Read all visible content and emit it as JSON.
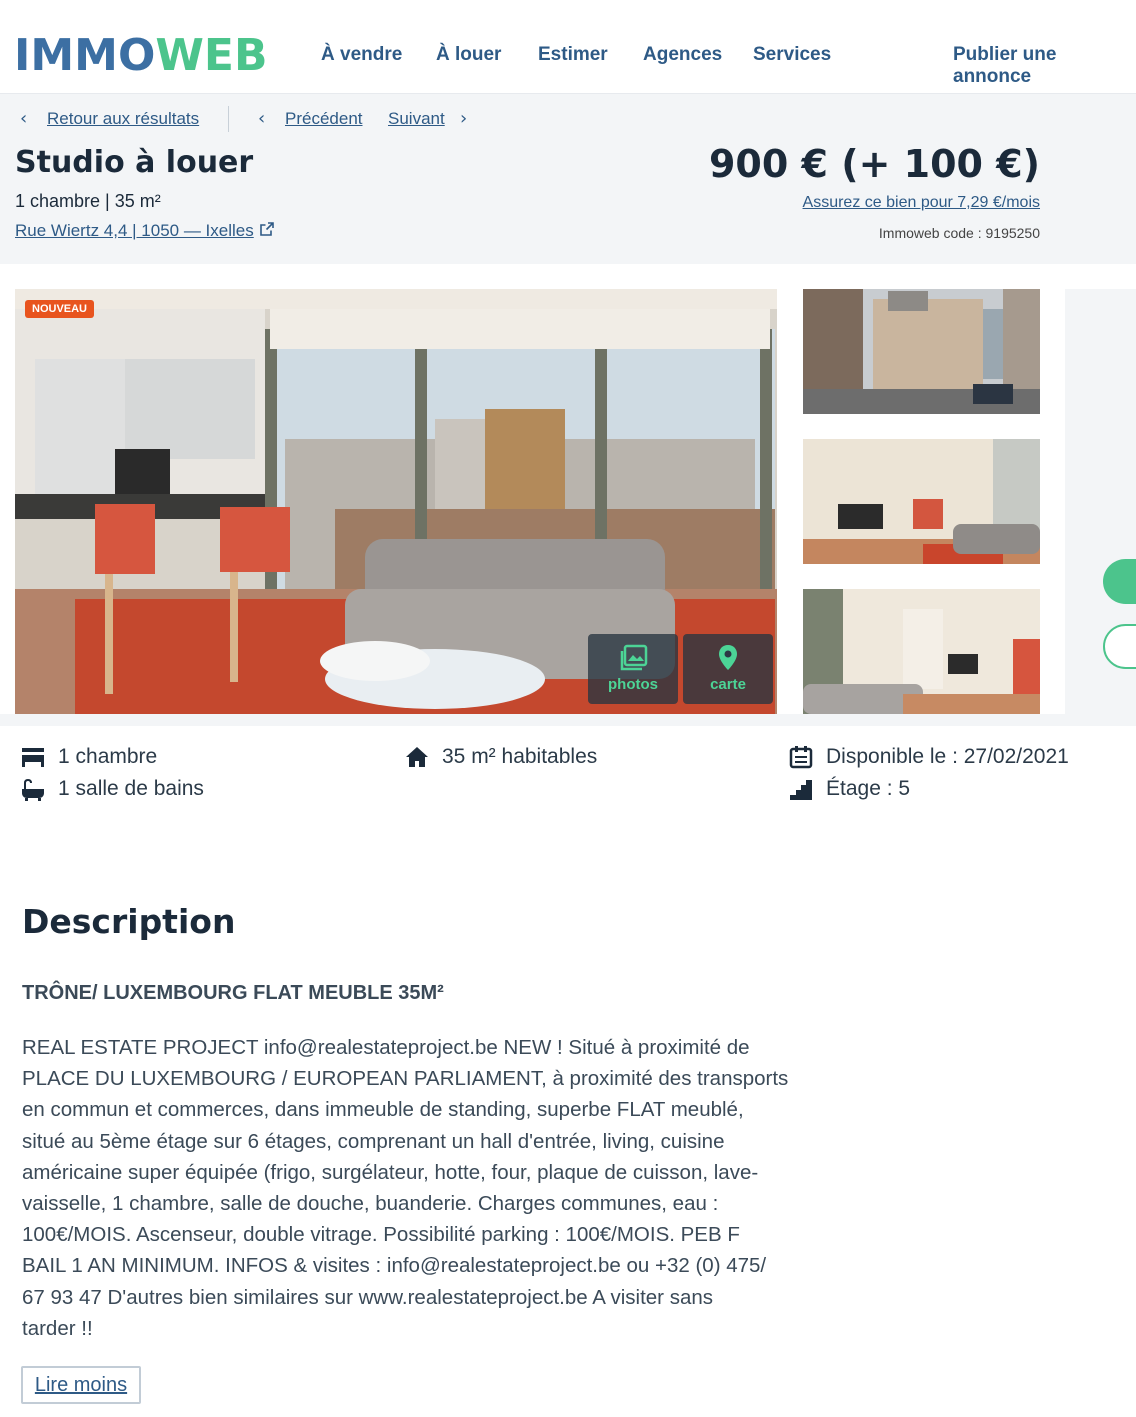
{
  "nav": {
    "logo_part1": "IMMO",
    "logo_part2": "WEB",
    "links": [
      "À vendre",
      "À louer",
      "Estimer",
      "Agences",
      "Services"
    ],
    "publish": "Publier une annonce"
  },
  "breadcrumb": {
    "back": "Retour aux résultats",
    "previous": "Précédent",
    "next": "Suivant"
  },
  "listing": {
    "title": "Studio à louer",
    "subtitle": "1 chambre | 35 m²",
    "address": "Rue Wiertz 4,4 | 1050 — Ixelles",
    "price": "900 € (+ 100 €)",
    "insurance_link": "Assurez ce bien pour 7,29 €/mois",
    "code": "Immoweb code : 9195250"
  },
  "gallery": {
    "badge": "NOUVEAU",
    "photos_label": "photos",
    "map_label": "carte"
  },
  "features": {
    "bedrooms": "1 chambre",
    "bathrooms": "1 salle de bains",
    "living_area": "35 m² habitables",
    "available": "Disponible le : 27/02/2021",
    "floor": "Étage : 5"
  },
  "description": {
    "heading": "Description",
    "subheading": "TRÔNE/ LUXEMBOURG FLAT MEUBLE 35M²",
    "lines": [
      "REAL ESTATE PROJECT info@realestateproject.be NEW ! Situé à proximité de",
      "PLACE DU LUXEMBOURG / EUROPEAN PARLIAMENT, à proximité des transports",
      "en commun et commerces, dans immeuble de standing, superbe FLAT meublé,",
      "situé au 5ème étage sur 6 étages, comprenant un hall d'entrée, living, cuisine",
      "américaine super équipée (frigo, surgélateur, hotte, four, plaque de cuisson, lave-",
      "vaisselle, 1 chambre, salle de douche, buanderie. Charges communes, eau :",
      "100€/MOIS. Ascenseur, double vitrage. Possibilité parking : 100€/MOIS. PEB F",
      "BAIL 1 AN MINIMUM. INFOS & visites : info@realestateproject.be ou +32 (0) 475/",
      "67 93 47 D'autres bien similaires sur www.realestateproject.be A visiter sans",
      "tarder !!"
    ],
    "read_less": "Lire moins"
  }
}
